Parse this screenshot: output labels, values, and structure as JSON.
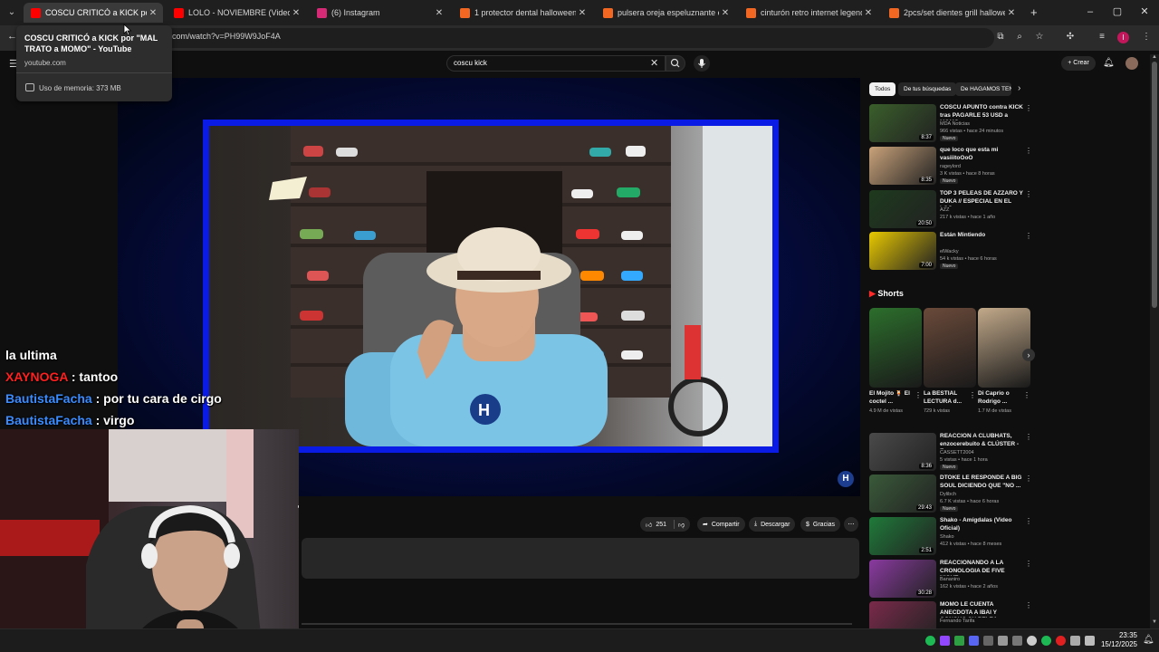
{
  "browser": {
    "tabs": [
      {
        "title": "COSCU CRITICÓ a KICK por \"MAL TRATO a MOMO\" - YouTube",
        "favicon_color": "#ff0000",
        "active": true
      },
      {
        "title": "LOLO - NOVIEMBRE (Video Oficial)",
        "favicon_color": "#ff0000",
        "active": false
      },
      {
        "title": "(6) Instagram",
        "favicon_color": "#d62976",
        "active": false
      },
      {
        "title": "1 protector dental halloween fa",
        "favicon_color": "#f26722",
        "active": false
      },
      {
        "title": "pulsera oreja espeluznante est",
        "favicon_color": "#f26722",
        "active": false
      },
      {
        "title": "cinturón retro internet legend",
        "favicon_color": "#f26722",
        "active": false
      },
      {
        "title": "2pcs/set dientes grill halloween",
        "favicon_color": "#f26722",
        "active": false
      }
    ],
    "new_tab": "+",
    "window_controls": {
      "minimize": "–",
      "maximize": "▢",
      "close": "✕"
    },
    "url": "com/watch?v=PH99W9JoF4A",
    "hover_card": {
      "title": "COSCU CRITICÓ a KICK por \"MAL TRATO a MOMO\" - YouTube",
      "domain": "youtube.com",
      "memory": "Uso de memoria: 373 MB"
    },
    "profile_initial": "I"
  },
  "youtube": {
    "search_query": "coscu kick",
    "create_label": "Crear",
    "actions": {
      "likes": "251",
      "share": "Compartir",
      "download": "Descargar",
      "thanks": "Gracias"
    },
    "chips": [
      {
        "label": "Todos",
        "active": true
      },
      {
        "label": "De tus búsquedas",
        "active": false
      },
      {
        "label": "De HAGAMOS TEN",
        "active": false
      }
    ],
    "recommendations_top": [
      {
        "title": "COSCU APUNTÓ contra KICK tras PAGARLE 53 USD a MOMO...",
        "channel": "MDA Noticias",
        "meta": "966 vistas • hace 24 minutos",
        "badge": "Nuevo",
        "duration": "8:37",
        "color": "#3a5f2b"
      },
      {
        "title": "que loco que esta mi vasiiitoOoO",
        "channel": "rageylord",
        "meta": "3 K vistas • hace 8 horas",
        "badge": "Nuevo",
        "duration": "8:35",
        "color": "#c9a27a"
      },
      {
        "title": "TOP 3 PELEAS DE AZZARO Y DUKA // ESPECIAL EN EL LOC...",
        "channel": "AZZ",
        "meta": "217 k vistas • hace 1 año",
        "badge": "",
        "duration": "20:50",
        "color": "#1e3a1e"
      },
      {
        "title": "Están Mintiendo",
        "channel": "elWacky",
        "meta": "54 k vistas • hace 6 horas",
        "badge": "Nuevo",
        "duration": "7:00",
        "color": "#e8c800"
      }
    ],
    "shorts_label": "Shorts",
    "shorts": [
      {
        "title": "El Mojito 🍹 El coctel ...",
        "views": "4.9 M de vistas",
        "color": "#2c6e2c"
      },
      {
        "title": "La BESTIAL LECTURA d...",
        "views": "729 k vistas",
        "color": "#6a4a3a"
      },
      {
        "title": "Di Caprio o Rodrigo ...",
        "views": "1.7 M de vistas",
        "color": "#c2a98a"
      }
    ],
    "recommendations_bottom": [
      {
        "title": "REACCION A CLUBHATS, enzocerebuito & CLÚSTER - E...",
        "channel": "CASSETT2004",
        "meta": "5 vistas • hace 1 hora",
        "badge": "Nuevo",
        "duration": "8:36",
        "color": "#4a4a4a"
      },
      {
        "title": "DTOKE LE RESPONDE A BIG SOUL DICIENDO QUE \"NO ...",
        "channel": "Dylibch",
        "meta": "6.7 K vistas • hace 6 horas",
        "badge": "Nuevo",
        "duration": "29:43",
        "color": "#3a5a3a"
      },
      {
        "title": "Shako - Amígdalas (Video Oficial)",
        "channel": "Shako",
        "meta": "412 k vistas • hace 8 meses",
        "badge": "",
        "duration": "2:51",
        "color": "#1f7a3a"
      },
      {
        "title": "REACCIONANDO A LA CRONOLOGIA DE FIVE NIGHT...",
        "channel": "Bananiro",
        "meta": "162 k vistas • hace 2 años",
        "badge": "",
        "duration": "30:28",
        "color": "#8a3aa0"
      },
      {
        "title": "MOMO LE CUENTA ANECDOTA A IBAI Y GONCHO SU PELEA ...",
        "channel": "Fernando Tarifa",
        "meta": "",
        "badge": "",
        "duration": "",
        "color": "#7a2a4a"
      }
    ]
  },
  "stream_overlay": {
    "chat": [
      {
        "user": "",
        "user_color": "#ffffff",
        "message": "la ultima"
      },
      {
        "user": "XAYNOGA",
        "user_color": "#ff2020",
        "message": " : tantoo"
      },
      {
        "user": "BautistaFacha",
        "user_color": "#3a8cff",
        "message": " : por tu cara de cirgo"
      },
      {
        "user": "BautistaFacha",
        "user_color": "#3a8cff",
        "message": " : virgo"
      }
    ]
  },
  "taskbar": {
    "time": "23:35",
    "date": "15/12/2025"
  }
}
